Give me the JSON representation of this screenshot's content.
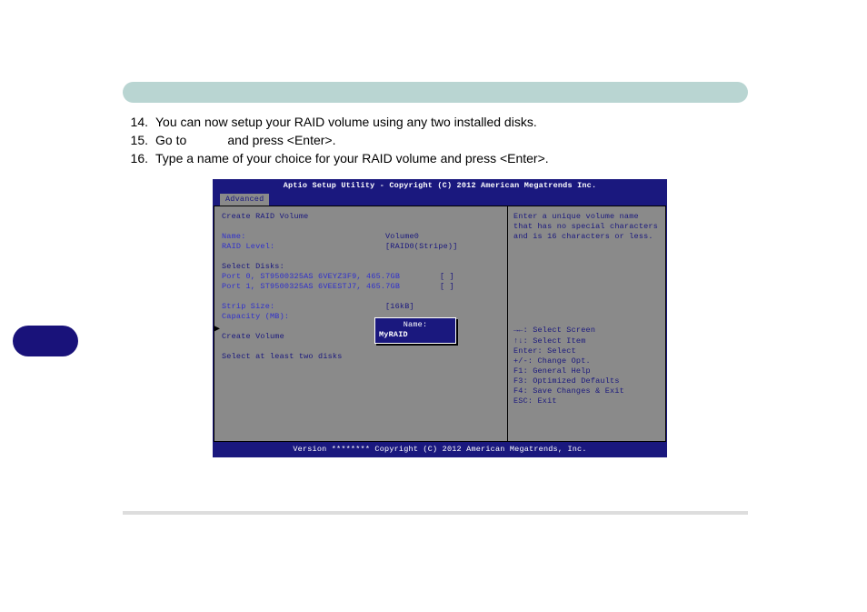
{
  "instructions": {
    "i14": {
      "n": "14.",
      "t": "You can now setup your RAID volume using any two installed disks."
    },
    "i15a": {
      "n": "15.",
      "t1": "Go to ",
      "t2": " and press <Enter>."
    },
    "i16": {
      "n": "16.",
      "t": "Type a name of your choice for your RAID volume and press <Enter>."
    }
  },
  "bios": {
    "title": "Aptio Setup Utility - Copyright (C) 2012 American Megatrends Inc.",
    "tab": "Advanced",
    "left": {
      "create": "Create RAID Volume",
      "name_lbl": "Name:",
      "name_val": "Volume0",
      "level_lbl": "RAID Level:",
      "level_val": "[RAID0(Stripe)]",
      "select_disks": "Select Disks:",
      "port0": "Port 0, ST9500325AS 6VEYZ3F9, 465.7GB",
      "port0_box": "[ ]",
      "port1": "Port 1, ST9500325AS 6VEESTJ7, 465.7GB",
      "port1_box": "[ ]",
      "strip_lbl": "Strip Size:",
      "strip_val": "[16kB]",
      "cap_lbl": "Capacity (MB):",
      "create_vol": "Create Volume",
      "warn": "Select at least two disks"
    },
    "popup": {
      "title": "Name:",
      "value": "MyRAID"
    },
    "right": {
      "help1": "Enter a unique volume name",
      "help2": "that has no special characters",
      "help3": "and is 16 characters or less.",
      "k1": "→←: Select Screen",
      "k2": "↑↓: Select Item",
      "k3": "Enter: Select",
      "k4": "+/-: Change Opt.",
      "k5": "F1: General Help",
      "k6": "F3: Optimized Defaults",
      "k7": "F4: Save Changes & Exit",
      "k8": "ESC: Exit"
    },
    "footer": "Version ******** Copyright (C) 2012 American Megatrends, Inc."
  }
}
